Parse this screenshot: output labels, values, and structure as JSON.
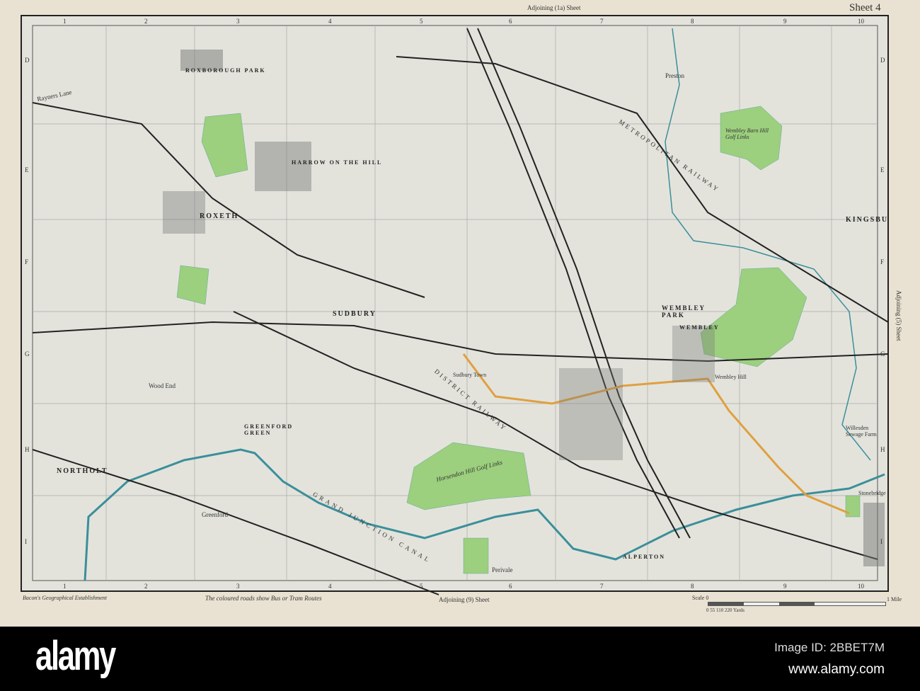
{
  "header": {
    "adjoining_top": "Adjoining (1a) Sheet",
    "sheet": "Sheet 4"
  },
  "grid": {
    "cols": [
      "1",
      "2",
      "3",
      "4",
      "5",
      "6",
      "7",
      "8",
      "9",
      "10"
    ],
    "rows": [
      "D",
      "E",
      "F",
      "G",
      "H",
      "I"
    ]
  },
  "places": [
    {
      "id": "roxborough",
      "label": "ROXBOROUGH PARK"
    },
    {
      "id": "harrow",
      "label": "HARROW ON THE HILL"
    },
    {
      "id": "roxeth",
      "label": "ROXETH"
    },
    {
      "id": "sudbury",
      "label": "SUDBURY"
    },
    {
      "id": "wembleypark",
      "label": "WEMBLEY PARK"
    },
    {
      "id": "wembley",
      "label": "WEMBLEY"
    },
    {
      "id": "kingsbury",
      "label": "KINGSBU"
    },
    {
      "id": "preston",
      "label": "Preston"
    },
    {
      "id": "northolt",
      "label": "NORTHOLT"
    },
    {
      "id": "greenfordgreen",
      "label": "GREENFORD GREEN"
    },
    {
      "id": "greenford",
      "label": "Greenford"
    },
    {
      "id": "woodend",
      "label": "Wood End"
    },
    {
      "id": "alperton",
      "label": "ALPERTON"
    },
    {
      "id": "perivale",
      "label": "Perivale"
    },
    {
      "id": "rayners",
      "label": "Rayners Lane"
    },
    {
      "id": "sudburytown",
      "label": "Sudbury Town"
    },
    {
      "id": "wembleyhill",
      "label": "Wembley Hill"
    },
    {
      "id": "stonebridge",
      "label": "Stonebridge"
    },
    {
      "id": "willesden",
      "label": "Willesden Sewage Farm"
    },
    {
      "id": "horsendon",
      "label": "Horsendon Hill Golf Links"
    },
    {
      "id": "barnhill",
      "label": "Wembley Barn Hill Golf Links"
    },
    {
      "id": "metro",
      "label": "METROPOLITAN RAILWAY"
    },
    {
      "id": "district",
      "label": "DISTRICT RAILWAY"
    },
    {
      "id": "canal",
      "label": "GRAND JUNCTION CANAL"
    }
  ],
  "footer_map": {
    "publisher": "Bacon's Geographical Establishment",
    "note": "The coloured roads show Bus or Tram Routes",
    "adjoining_bottom": "Adjoining (9) Sheet",
    "adjoining_right": "Adjoining (5) Sheet",
    "scale_label": "Scale 0",
    "scale_yards": "0 55 110 220 Yards",
    "scale_mile": "1 Mile"
  },
  "watermark": {
    "logo": "alamy",
    "image_id": "Image ID: 2BBET7M",
    "url": "www.alamy.com"
  },
  "colors": {
    "paper": "#e9e2d2",
    "land": "#e3e3dc",
    "park": "#9ccf7e",
    "water": "#3b8f9a",
    "bus": "#e0a040"
  }
}
